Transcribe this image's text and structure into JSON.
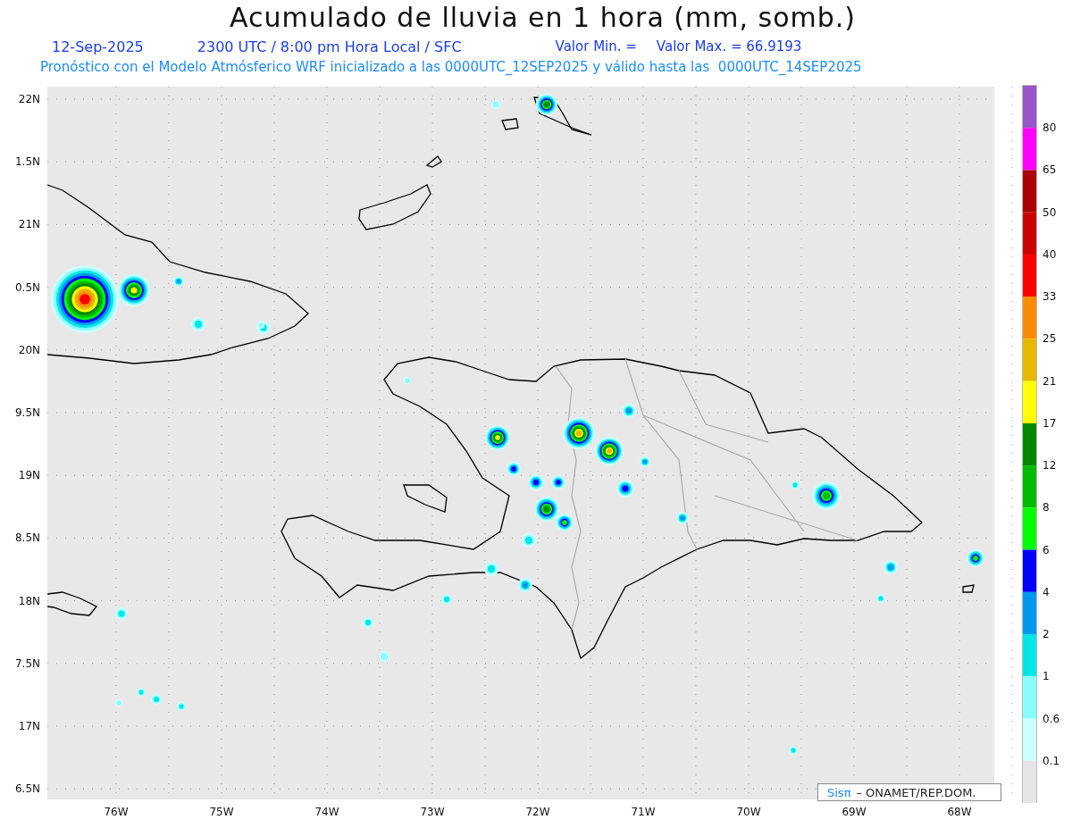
{
  "title": "Acumulado de lluvia en 1 hora (mm, somb.)",
  "header": {
    "date": "12-Sep-2025",
    "time": "2300 UTC / 8:00 pm Hora Local / SFC",
    "min": "Valor Min. =",
    "max": "Valor Max. = 66.9193"
  },
  "subtitle": "Pronóstico con el Modelo Atmósferico WRF inicializado a las 0000UTC_12SEP2025 y válido hasta las  0000UTC_14SEP2025",
  "y_axis": [
    "22N",
    "1.5N",
    "21N",
    "0.5N",
    "20N",
    "9.5N",
    "19N",
    "8.5N",
    "18N",
    "7.5N",
    "17N",
    "6.5N"
  ],
  "x_axis": [
    "76W",
    "75W",
    "74W",
    "73W",
    "72W",
    "71W",
    "70W",
    "69W",
    "68W"
  ],
  "legend": [
    {
      "color": "#9955cc",
      "label": "80"
    },
    {
      "color": "#ff00ff",
      "label": "65"
    },
    {
      "color": "#aa0000",
      "label": "50"
    },
    {
      "color": "#cc0000",
      "label": "40"
    },
    {
      "color": "#ff0000",
      "label": "33"
    },
    {
      "color": "#ff8c00",
      "label": "25"
    },
    {
      "color": "#e6b800",
      "label": "21"
    },
    {
      "color": "#ffff00",
      "label": "17"
    },
    {
      "color": "#008800",
      "label": "12"
    },
    {
      "color": "#00bb00",
      "label": "8"
    },
    {
      "color": "#00ff00",
      "label": "6"
    },
    {
      "color": "#0000ff",
      "label": "4"
    },
    {
      "color": "#0099ee",
      "label": "2"
    },
    {
      "color": "#00e6e6",
      "label": "1"
    },
    {
      "color": "#88ffff",
      "label": "0.6"
    },
    {
      "color": "#ccffff",
      "label": "0.1"
    },
    {
      "color": "#e6e6e6"
    }
  ],
  "credit": {
    "brand": "Sisπ",
    "text": "– ONAMET/REP.DOM."
  }
}
